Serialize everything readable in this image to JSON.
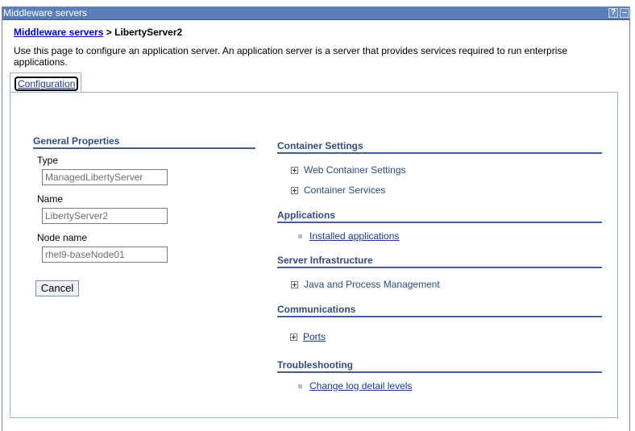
{
  "window": {
    "title": "Middleware servers",
    "help_label": "?",
    "minimize_label": "–"
  },
  "breadcrumb": {
    "link": "Middleware servers",
    "separator": ">",
    "current": "LibertyServer2"
  },
  "description": "Use this page to configure an application server. An application server is a server that provides services required to run enterprise applications.",
  "tabs": [
    {
      "label": "Configuration"
    }
  ],
  "general": {
    "heading": "General Properties",
    "type_label": "Type",
    "type_value": "ManagedLibertyServer",
    "name_label": "Name",
    "name_value": "LibertyServer2",
    "node_label": "Node name",
    "node_value": "rhel9-baseNode01",
    "cancel_label": "Cancel"
  },
  "container": {
    "heading": "Container Settings",
    "items": [
      "Web Container Settings",
      "Container Services"
    ]
  },
  "applications": {
    "heading": "Applications",
    "items": [
      "Installed applications"
    ]
  },
  "infrastructure": {
    "heading": "Server Infrastructure",
    "items": [
      "Java and Process Management"
    ]
  },
  "communications": {
    "heading": "Communications",
    "items": [
      "Ports"
    ]
  },
  "troubleshooting": {
    "heading": "Troubleshooting",
    "items": [
      "Change log detail levels"
    ]
  }
}
